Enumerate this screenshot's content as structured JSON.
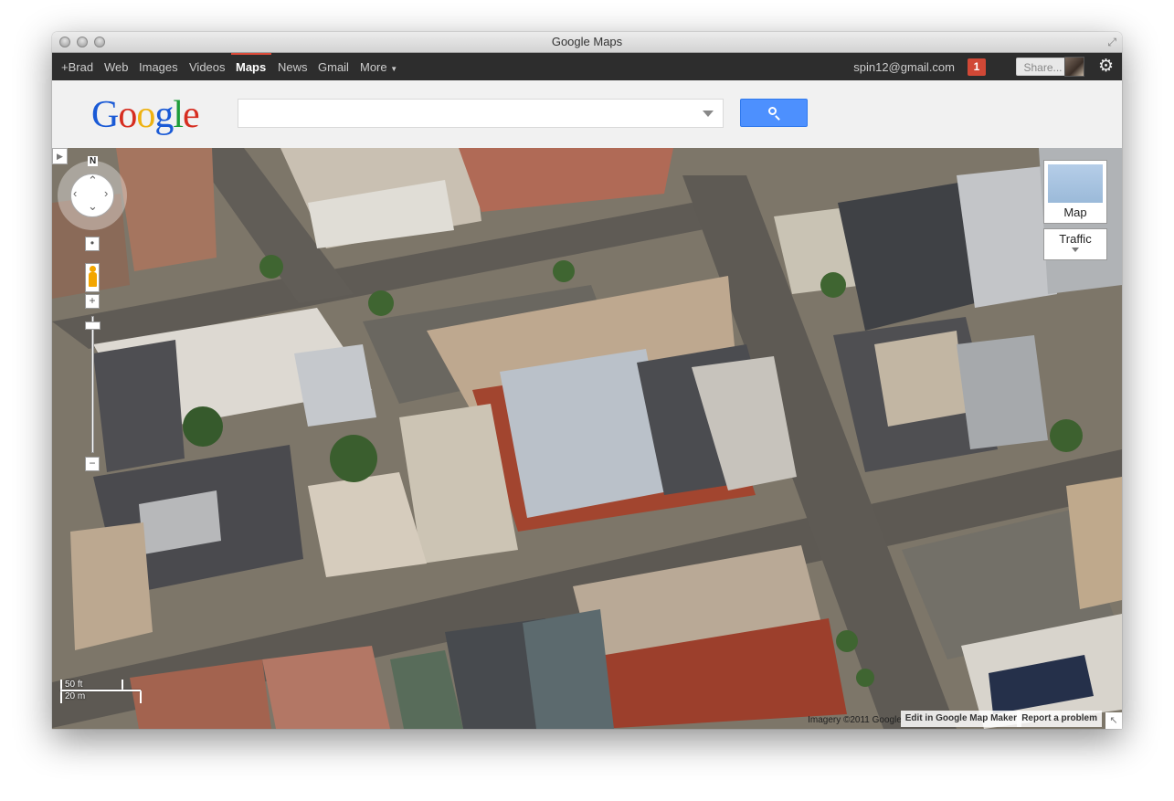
{
  "window": {
    "title": "Google Maps"
  },
  "nav": {
    "items": [
      "+Brad",
      "Web",
      "Images",
      "Videos",
      "Maps",
      "News",
      "Gmail",
      "More"
    ],
    "active": "Maps",
    "email": "spin12@gmail.com",
    "notification_count": "1",
    "share_label": "Share..."
  },
  "search": {
    "logo": "Google",
    "value": "",
    "placeholder": ""
  },
  "map": {
    "compass_label": "N",
    "maptype_label": "Map",
    "traffic_label": "Traffic",
    "scale_top": "50 ft",
    "scale_bottom": "20 m",
    "imagery_credit": "Imagery ©2011 Google -",
    "edit_link": "Edit in Google Map Maker",
    "report_link": "Report a problem"
  },
  "colors": {
    "accent_red": "#dd4b39",
    "search_blue": "#4d90fe",
    "nav_bg": "#2d2d2d"
  }
}
